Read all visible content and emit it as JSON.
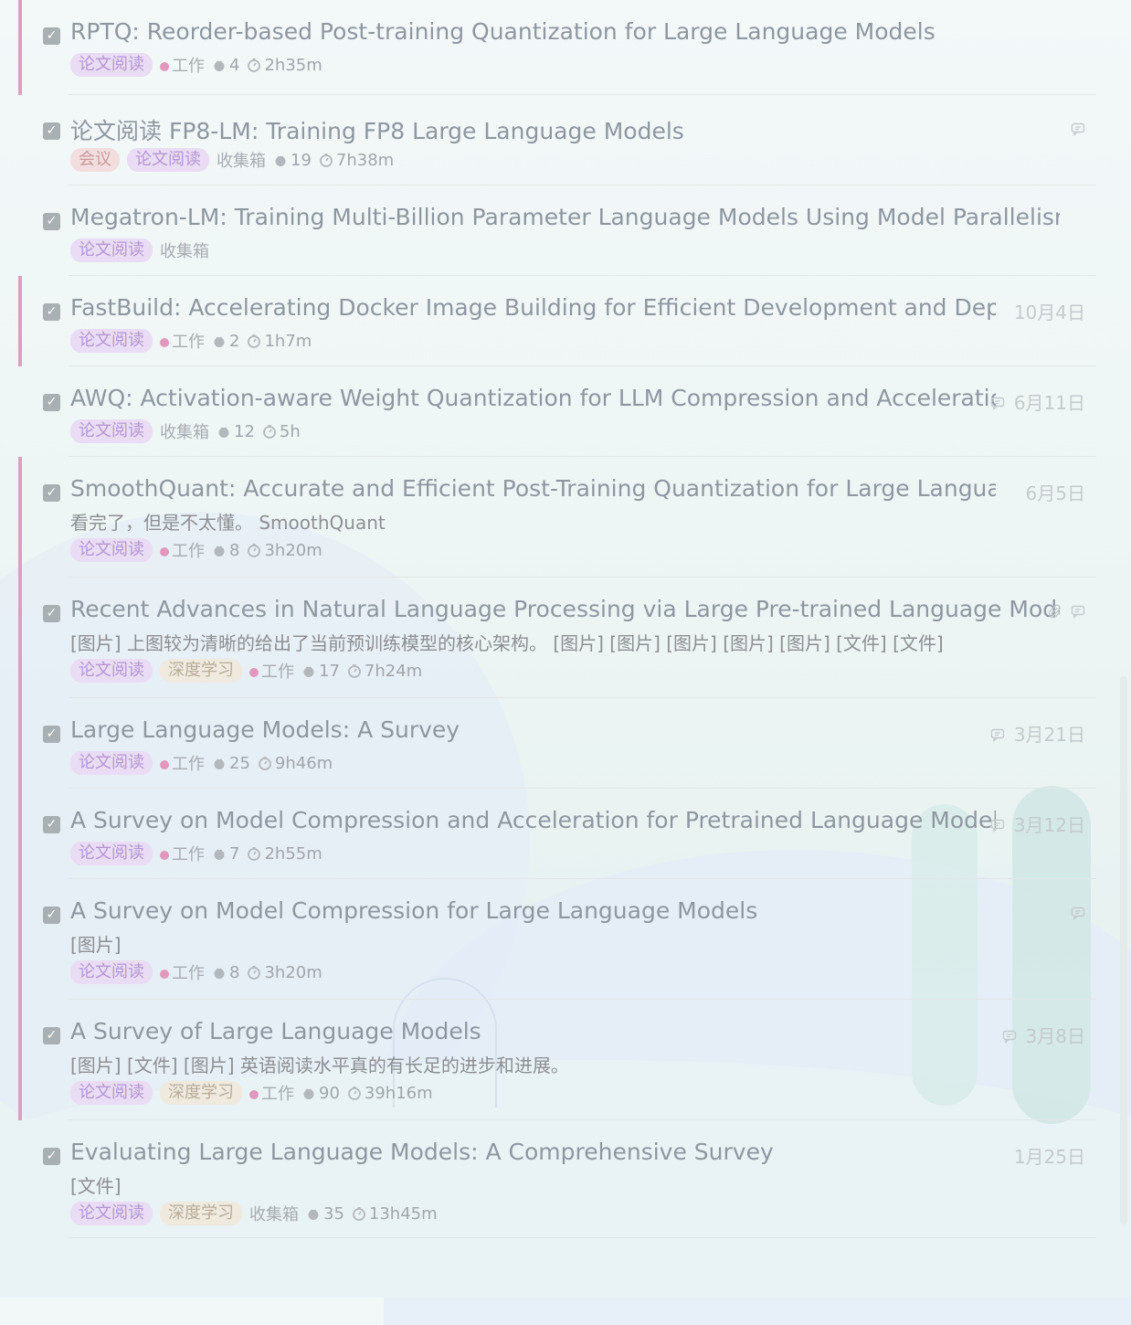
{
  "tasks": [
    {
      "title": "RPTQ: Reorder-based Post-training Quantization for Large Language Models",
      "note": "",
      "tags": [
        {
          "label": "论文阅读",
          "style": "purple"
        }
      ],
      "list": "工作",
      "list_dot": true,
      "pomos": "4",
      "duration": "2h35m",
      "date": "",
      "comment": false,
      "attachment": false,
      "accent": true
    },
    {
      "title": "论文阅读 FP8-LM: Training FP8 Large Language Models",
      "note": "",
      "tags": [
        {
          "label": "会议",
          "style": "pink"
        },
        {
          "label": "论文阅读",
          "style": "purple"
        }
      ],
      "list": "收集箱",
      "list_dot": false,
      "pomos": "19",
      "duration": "7h38m",
      "date": "",
      "comment": true,
      "attachment": false,
      "accent": false
    },
    {
      "title": "Megatron-LM: Training Multi-Billion Parameter Language Models Using Model Parallelism",
      "note": "",
      "tags": [
        {
          "label": "论文阅读",
          "style": "purple"
        }
      ],
      "list": "收集箱",
      "list_dot": false,
      "pomos": "",
      "duration": "",
      "date": "",
      "comment": false,
      "attachment": false,
      "accent": false
    },
    {
      "title": "FastBuild: Accelerating Docker Image Building for Efficient Development and Deploymen",
      "note": "",
      "tags": [
        {
          "label": "论文阅读",
          "style": "purple"
        }
      ],
      "list": "工作",
      "list_dot": true,
      "pomos": "2",
      "duration": "1h7m",
      "date": "10月4日",
      "comment": false,
      "attachment": false,
      "accent": true
    },
    {
      "title": "AWQ: Activation-aware Weight Quantization for LLM Compression and Acceleration",
      "note": "",
      "tags": [
        {
          "label": "论文阅读",
          "style": "purple"
        }
      ],
      "list": "收集箱",
      "list_dot": false,
      "pomos": "12",
      "duration": "5h",
      "date": "6月11日",
      "comment": true,
      "attachment": false,
      "accent": false
    },
    {
      "title": "SmoothQuant: Accurate and Efficient Post-Training Quantization for Large Language Mod",
      "note": "看完了，但是不太懂。 SmoothQuant",
      "tags": [
        {
          "label": "论文阅读",
          "style": "purple"
        }
      ],
      "list": "工作",
      "list_dot": true,
      "pomos": "8",
      "duration": "3h20m",
      "date": "6月5日",
      "comment": false,
      "attachment": false,
      "accent": true
    },
    {
      "title": "Recent Advances in Natural Language Processing via Large Pre-trained Language Models: A",
      "note": " [图片]  上图较为清晰的给出了当前预训练模型的核心架构。   [图片] [图片]    [图片]   [图片] [图片]  [文件]   [文件]",
      "tags": [
        {
          "label": "论文阅读",
          "style": "purple"
        },
        {
          "label": "深度学习",
          "style": "beige"
        }
      ],
      "list": "工作",
      "list_dot": true,
      "pomos": "17",
      "duration": "7h24m",
      "date": "",
      "comment": true,
      "attachment": true,
      "accent": true
    },
    {
      "title": "Large Language Models: A Survey",
      "note": "",
      "tags": [
        {
          "label": "论文阅读",
          "style": "purple"
        }
      ],
      "list": "工作",
      "list_dot": true,
      "pomos": "25",
      "duration": "9h46m",
      "date": "3月21日",
      "comment": true,
      "attachment": false,
      "accent": true
    },
    {
      "title": "A Survey on Model Compression and Acceleration for Pretrained Language Models #",
      "note": "",
      "tags": [
        {
          "label": "论文阅读",
          "style": "purple"
        }
      ],
      "list": "工作",
      "list_dot": true,
      "pomos": "7",
      "duration": "2h55m",
      "date": "3月12日",
      "comment": true,
      "attachment": false,
      "accent": true
    },
    {
      "title": "A Survey on Model Compression for Large Language Models",
      "note": "  [图片]",
      "tags": [
        {
          "label": "论文阅读",
          "style": "purple"
        }
      ],
      "list": "工作",
      "list_dot": true,
      "pomos": "8",
      "duration": "3h20m",
      "date": "",
      "comment": true,
      "attachment": false,
      "accent": true
    },
    {
      "title": "A Survey of Large Language Models",
      "note": " [图片] [文件]   [图片]   英语阅读水平真的有长足的进步和进展。",
      "tags": [
        {
          "label": "论文阅读",
          "style": "purple"
        },
        {
          "label": "深度学习",
          "style": "beige"
        }
      ],
      "list": "工作",
      "list_dot": true,
      "pomos": "90",
      "duration": "39h16m",
      "date": "3月8日",
      "comment": true,
      "attachment": false,
      "accent": true
    },
    {
      "title": "Evaluating Large Language Models: A Comprehensive Survey",
      "note": "[文件]",
      "tags": [
        {
          "label": "论文阅读",
          "style": "purple"
        },
        {
          "label": "深度学习",
          "style": "beige"
        }
      ],
      "list": "收集箱",
      "list_dot": false,
      "pomos": "35",
      "duration": "13h45m",
      "date": "1月25日",
      "comment": false,
      "attachment": false,
      "accent": false
    }
  ]
}
